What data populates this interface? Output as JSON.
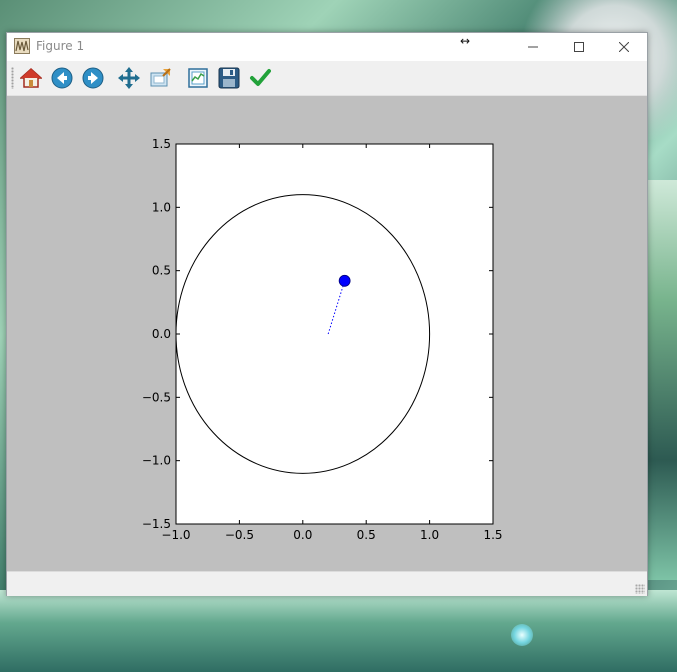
{
  "window": {
    "title": "Figure 1",
    "resize_cursor": "↔"
  },
  "toolbar": {
    "buttons": [
      {
        "name": "home-icon"
      },
      {
        "name": "back-icon"
      },
      {
        "name": "forward-icon"
      },
      {
        "name": "pan-icon"
      },
      {
        "name": "zoom-icon"
      },
      {
        "name": "configure-subplots-icon"
      },
      {
        "name": "save-icon"
      },
      {
        "name": "edit-parameters-icon"
      }
    ]
  },
  "status": {
    "message": ""
  },
  "chart_data": {
    "type": "line",
    "title": "",
    "xlabel": "",
    "ylabel": "",
    "xlim": [
      -1.0,
      1.5
    ],
    "ylim": [
      -1.5,
      1.5
    ],
    "xticks": [
      "−1.0",
      "−0.5",
      "0.0",
      "0.5",
      "1.0",
      "1.5"
    ],
    "xtick_values": [
      -1.0,
      -0.5,
      0.0,
      0.5,
      1.0,
      1.5
    ],
    "yticks": [
      "1.5",
      "1.0",
      "0.5",
      "0.0",
      "−0.5",
      "−1.0",
      "−1.5"
    ],
    "ytick_values": [
      1.5,
      1.0,
      0.5,
      0.0,
      -0.5,
      -1.0,
      -1.5
    ],
    "grid": false,
    "series": [
      {
        "kind": "ellipse-outline",
        "center": [
          0.0,
          0.0
        ],
        "radius_x": 1.0,
        "radius_y": 1.1,
        "color": "#000000"
      },
      {
        "kind": "dotted-line",
        "x": [
          0.2,
          0.33
        ],
        "y": [
          0.0,
          0.42
        ],
        "color": "#0000ff"
      },
      {
        "kind": "marker",
        "x": 0.33,
        "y": 0.42,
        "color": "#0000ff"
      }
    ]
  },
  "colors": {
    "canvas_bg": "#bfbfbf",
    "axes_bg": "#ffffff",
    "accent_blue": "#0000ff"
  }
}
